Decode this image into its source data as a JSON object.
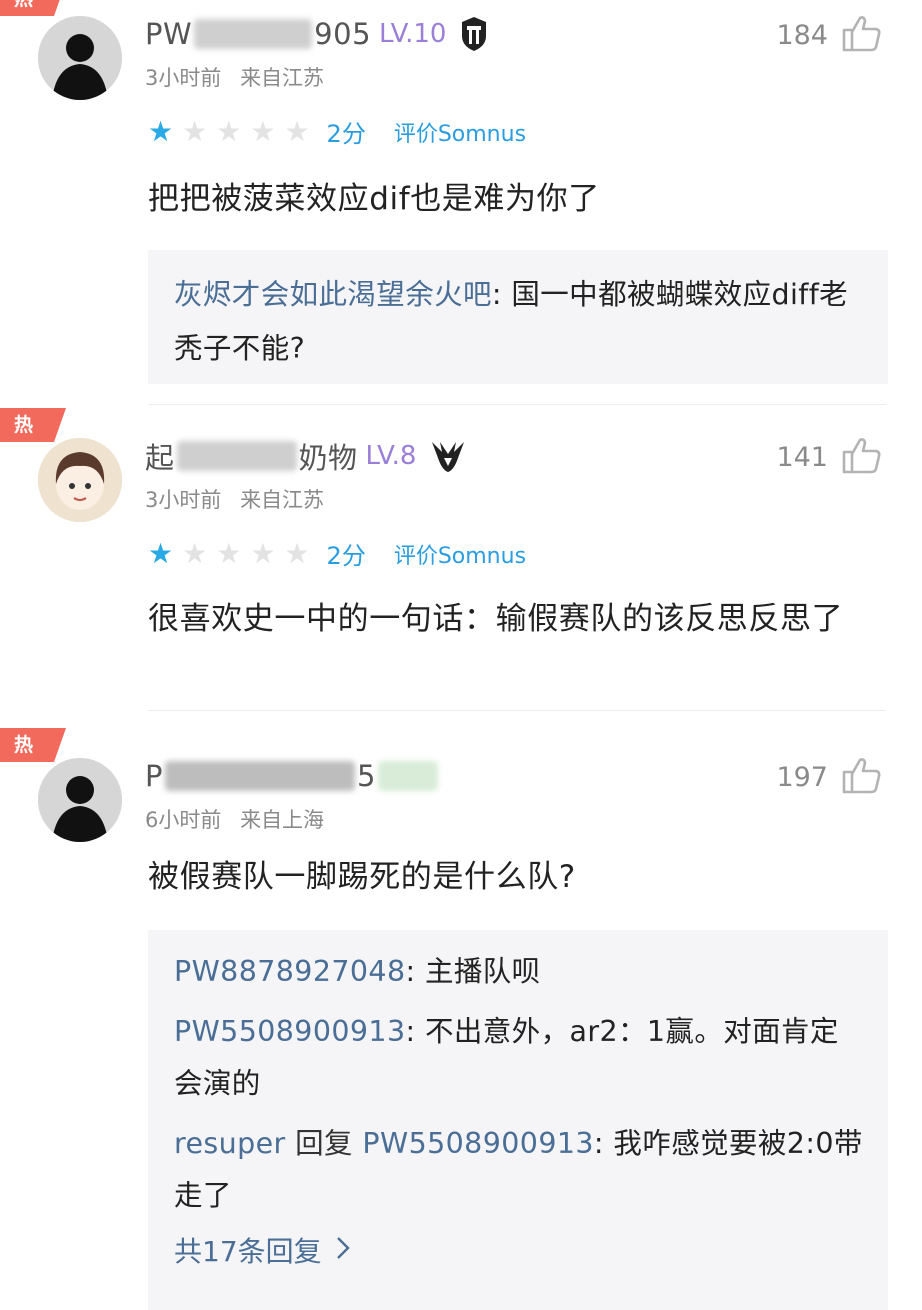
{
  "comments": [
    {
      "hot_label": "热",
      "username_prefix": "PW",
      "username_suffix": "905",
      "level": "LV.10",
      "team_icon": "gen-g-icon",
      "time": "3小时前",
      "location": "来自江苏",
      "likes": "184",
      "rating": {
        "stars_filled": 1,
        "stars_total": 5,
        "score": "2分",
        "target": "评价Somnus"
      },
      "text": "把把被菠菜效应dif也是难为你了",
      "replies": [
        {
          "name": "灰烬才会如此渴望余火吧",
          "sep": ": ",
          "text": "国一中都被蝴蝶效应diff老秃子不能?"
        }
      ]
    },
    {
      "hot_label": "热",
      "username_prefix": "起",
      "username_suffix": "奶物",
      "level": "LV.8",
      "team_icon": "team-vitality-icon",
      "time": "3小时前",
      "location": "来自江苏",
      "likes": "141",
      "rating": {
        "stars_filled": 1,
        "stars_total": 5,
        "score": "2分",
        "target": "评价Somnus"
      },
      "text": "很喜欢史一中的一句话：输假赛队的该反思反思了"
    },
    {
      "hot_label": "热",
      "username_prefix": "P",
      "username_suffix": "5",
      "time": "6小时前",
      "location": "来自上海",
      "likes": "197",
      "text": "被假赛队一脚踢死的是什么队?",
      "replies": [
        {
          "name": "PW8878927048",
          "sep": ": ",
          "text": "主播队呗"
        },
        {
          "name": "PW5508900913",
          "sep": ": ",
          "text": "不出意外，ar2：1赢。对面肯定会演的"
        },
        {
          "name": "resuper",
          "verb": " 回复 ",
          "target": "PW5508900913",
          "sep": ": ",
          "text": "我咋感觉要被2:0带走了"
        }
      ],
      "more_replies": "共17条回复"
    }
  ],
  "colors": {
    "hot_badge": "#f26a5b",
    "level": "#9a7fd8",
    "accent_blue": "#2a9de0",
    "reply_name": "#4a6e95",
    "reply_bg": "#f5f5f7"
  }
}
